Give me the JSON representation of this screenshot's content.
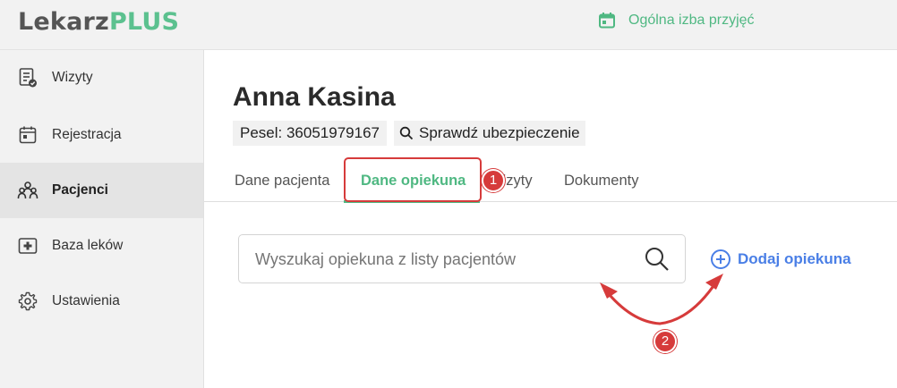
{
  "app": {
    "logo_part1": "Lekarz",
    "logo_part2": "PLUS",
    "location": "Ogólna izba przyjęć"
  },
  "sidebar": {
    "items": [
      {
        "label": "Wizyty",
        "icon": "document-check-icon"
      },
      {
        "label": "Rejestracja",
        "icon": "calendar-icon"
      },
      {
        "label": "Pacjenci",
        "icon": "people-icon",
        "active": true
      },
      {
        "label": "Baza leków",
        "icon": "medical-plus-icon"
      },
      {
        "label": "Ustawienia",
        "icon": "gear-icon"
      }
    ]
  },
  "patient": {
    "name": "Anna Kasina",
    "pesel": "Pesel: 36051979167",
    "check_insurance": "Sprawdź ubezpieczenie"
  },
  "tabs": [
    {
      "label": "Dane pacjenta"
    },
    {
      "label": "Dane opiekuna",
      "active": true
    },
    {
      "label": "Wizyty"
    },
    {
      "label": "Dokumenty"
    }
  ],
  "guardian": {
    "search_placeholder": "Wyszukaj opiekuna z listy pacjentów",
    "add_label": "Dodaj opiekuna"
  },
  "annotations": {
    "step1": "1",
    "step2": "2",
    "color": "#d63b3b"
  },
  "colors": {
    "brand_green": "#4fb882",
    "link_blue": "#4a7fe6"
  }
}
